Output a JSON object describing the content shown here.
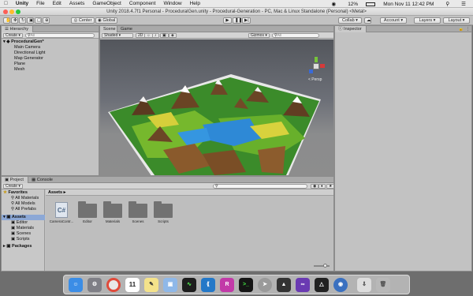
{
  "menubar": {
    "apple": "",
    "app_name": "Unity",
    "items": [
      "File",
      "Edit",
      "Assets",
      "GameObject",
      "Component",
      "Window",
      "Help"
    ],
    "battery": "12%",
    "datetime": "Mon Nov 11  12:42 PM"
  },
  "window": {
    "title": "Unity 2018.4.7f1 Personal - ProceduralGen.unity - Procedural-Generation - PC, Mac & Linux Standalone (Personal) <Metal>"
  },
  "toolbar": {
    "pivot": "Center",
    "space": "Global",
    "collab": "Collab",
    "account": "Account",
    "layers": "Layers",
    "layout": "Layout"
  },
  "hierarchy": {
    "tab": "Hierarchy",
    "create": "Create",
    "search_placeholder": "All",
    "scene": "ProceduralGen*",
    "items": [
      "Main Camera",
      "Directional Light",
      "Map Generator",
      "Plane",
      "Mesh"
    ]
  },
  "scene_view": {
    "tabs": [
      "Scene",
      "Game"
    ],
    "shading": "Shaded",
    "mode_2d": "2D",
    "gizmos": "Gizmos",
    "search_placeholder": "All",
    "persp": "< Persp"
  },
  "inspector": {
    "tab": "Inspector"
  },
  "project": {
    "tabs": [
      "Project",
      "Console"
    ],
    "create": "Create",
    "favorites": "Favorites",
    "favorite_items": [
      "All Materials",
      "All Models",
      "All Prefabs"
    ],
    "assets_root": "Assets",
    "asset_folders": [
      "Editor",
      "Materials",
      "Scenes",
      "Scripts"
    ],
    "packages": "Packages",
    "breadcrumb": "Assets",
    "grid_items": [
      {
        "label": "CameraContr...",
        "icon": "csharp-script-icon"
      },
      {
        "label": "Editor",
        "icon": "folder-icon"
      },
      {
        "label": "Materials",
        "icon": "folder-icon"
      },
      {
        "label": "Scenes",
        "icon": "folder-icon"
      },
      {
        "label": "Scripts",
        "icon": "folder-icon"
      }
    ]
  },
  "dock": {
    "apps": [
      "finder-icon",
      "system-preferences-icon",
      "chrome-icon",
      "calendar-icon",
      "notes-icon",
      "preview-icon",
      "activity-monitor-icon",
      "vscode-icon",
      "rider-icon",
      "terminal-icon",
      "launchpad-icon",
      "unity-icon",
      "visual-studio-icon",
      "unity-hub-icon",
      "cleanup-icon",
      "downloads-icon",
      "trash-icon"
    ],
    "calendar_day": "11"
  }
}
